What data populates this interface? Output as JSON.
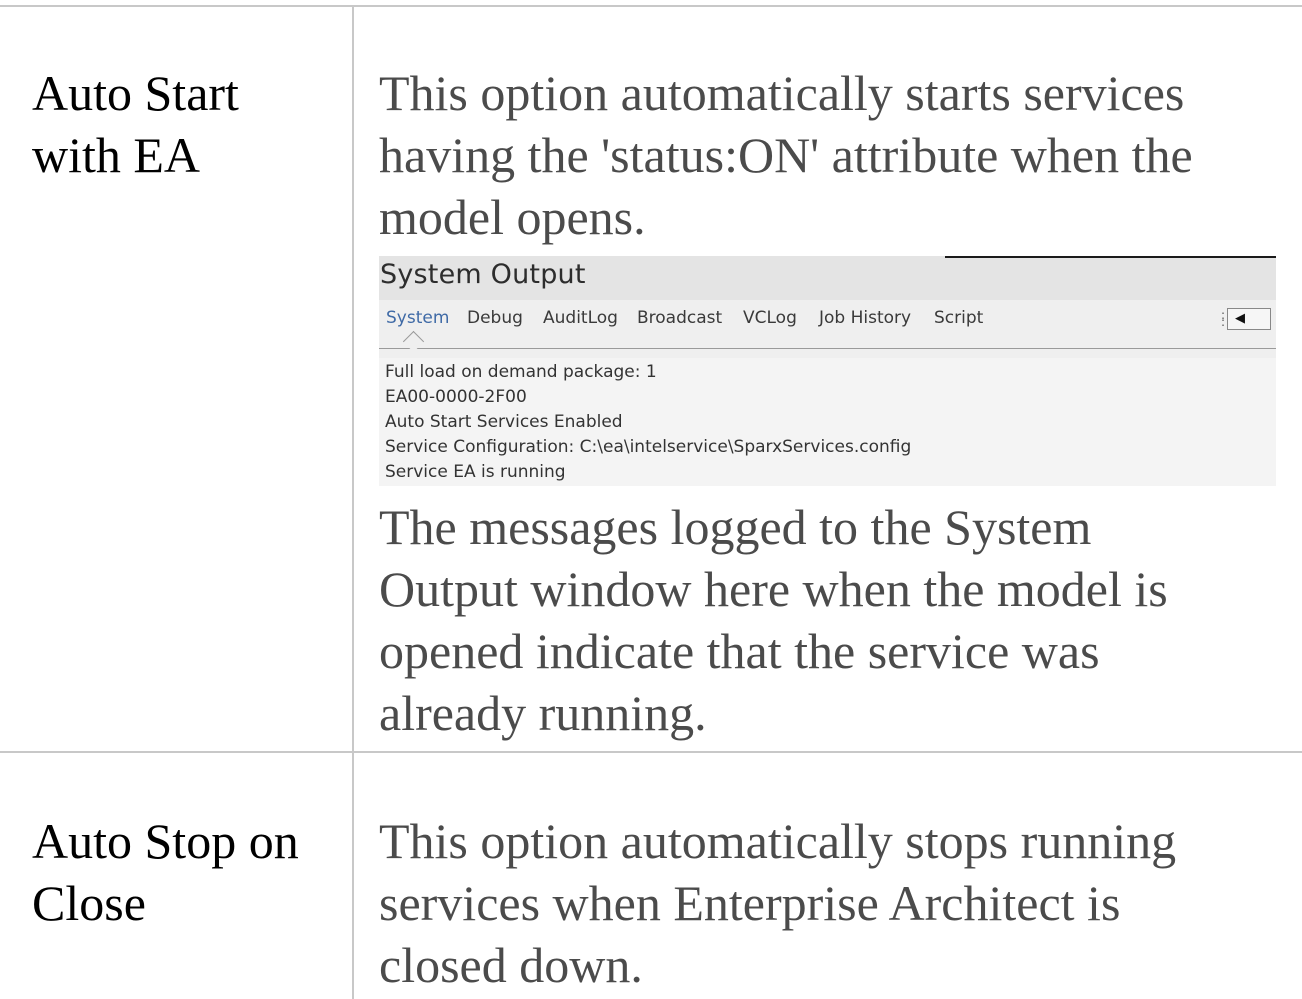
{
  "rows": [
    {
      "option": [
        "Auto Start",
        "with EA"
      ],
      "description_before": [
        "This option automatically starts services",
        "having the 'status:ON' attribute when the",
        "model opens."
      ],
      "description_after": [
        "The messages logged to the System",
        "Output window here when the model is",
        "opened indicate that the service was",
        "already running."
      ]
    },
    {
      "option": [
        "Auto Stop on",
        "Close"
      ],
      "description": [
        "This option automatically stops running",
        "services when Enterprise Architect is",
        "closed down."
      ]
    }
  ],
  "system_output": {
    "title": "System Output",
    "tabs": [
      "System",
      "Debug",
      "AuditLog",
      "Broadcast",
      "VCLog",
      "Job History",
      "Script"
    ],
    "active_tab": "System",
    "lines": [
      "Full load on demand package: 1",
      "EA00-0000-2F00",
      "Auto Start Services Enabled",
      "Service Configuration: C:\\ea\\intelservice\\SparxServices.config",
      "Service EA is running"
    ]
  },
  "icons": [
    "grip-icon",
    "scroll-left-icon"
  ]
}
